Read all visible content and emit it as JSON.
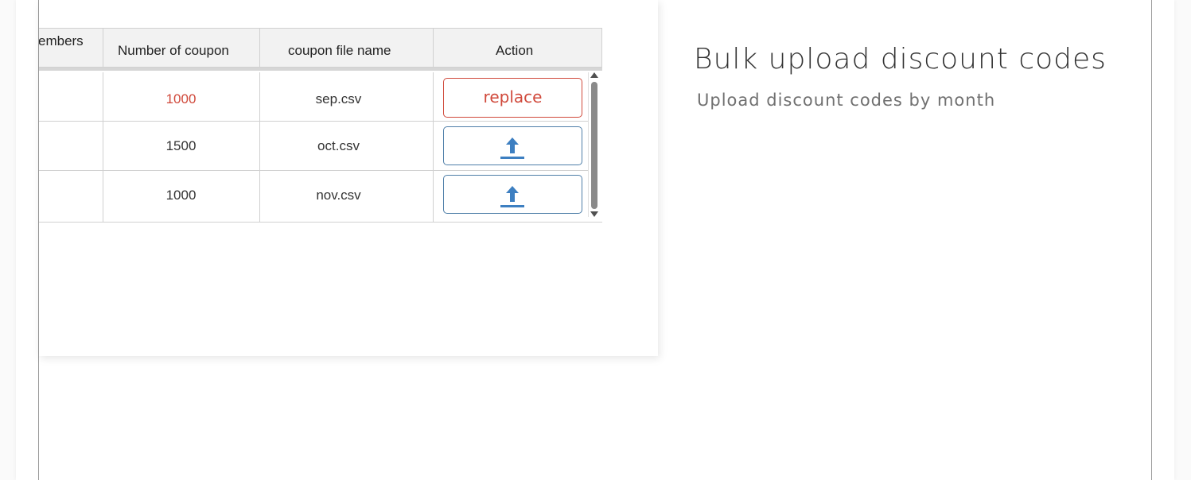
{
  "table": {
    "headers": [
      "embers",
      "Number of coupon",
      "coupon file name",
      "Action"
    ],
    "rows": [
      {
        "members": "",
        "count": "1000",
        "file": "sep.csv",
        "action_label": "replace",
        "action_type": "replace",
        "count_color": "#d0493b"
      },
      {
        "members": "",
        "count": "1500",
        "file": "oct.csv",
        "action_label": "",
        "action_type": "upload",
        "action_icon": "upload-icon"
      },
      {
        "members": "",
        "count": "1000",
        "file": "nov.csv",
        "action_label": "",
        "action_type": "upload",
        "action_icon": "upload-icon"
      }
    ]
  },
  "panel": {
    "title": "Bulk upload discount codes",
    "subtitle": "Upload discount codes by month"
  },
  "colors": {
    "accent_red": "#d0493b",
    "accent_blue": "#3d7fc1",
    "upload_border": "#4e7ea8"
  }
}
